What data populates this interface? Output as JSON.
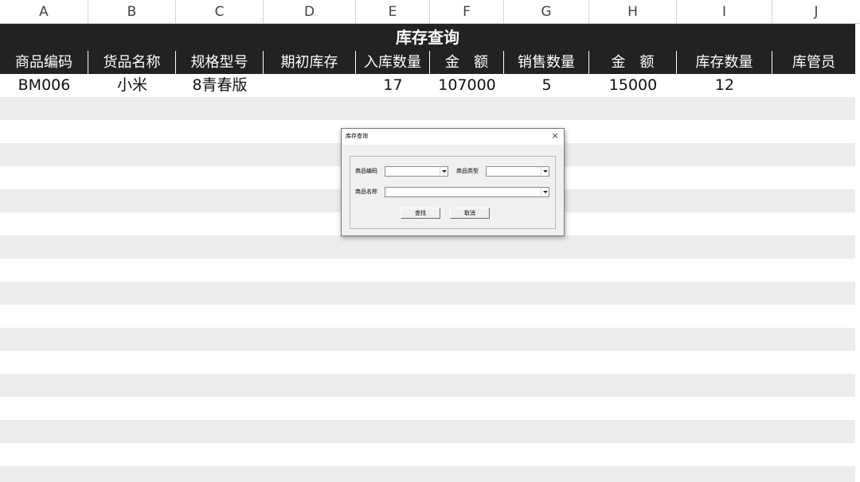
{
  "columns": [
    "A",
    "B",
    "C",
    "D",
    "E",
    "F",
    "G",
    "H",
    "I",
    "J"
  ],
  "title": "库存查询",
  "headers": [
    "商品编码",
    "货品名称",
    "规格型号",
    "期初库存",
    "入库数量",
    "金　额",
    "销售数量",
    "金　额",
    "库存数量",
    "库管员"
  ],
  "row": [
    "BM006",
    "小米",
    "8青春版",
    "",
    "17",
    "107000",
    "5",
    "15000",
    "12",
    ""
  ],
  "dialog": {
    "title": "库存查询",
    "close_glyph": "×",
    "code_label": "商品编码",
    "code_value": "",
    "type_label": "商品类型",
    "type_value": "",
    "name_label": "商品名称",
    "name_value": "",
    "search_button": "查找",
    "cancel_button": "取消"
  },
  "colors": {
    "header_bg": "#222222",
    "stripe": "#ececec"
  }
}
